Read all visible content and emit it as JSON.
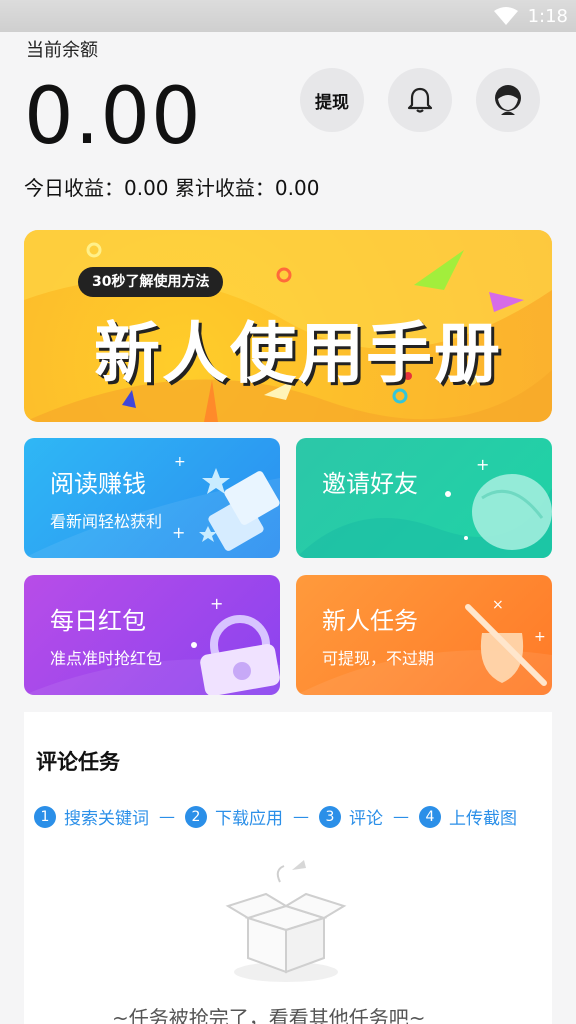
{
  "status": {
    "time": "1:18"
  },
  "balance": {
    "label": "当前余额",
    "amount": "0.00",
    "earnings": "今日收益：0.00 累计收益：0.00"
  },
  "header_buttons": {
    "withdraw_label": "提现"
  },
  "banner": {
    "pill_text": "30秒了解使用方法",
    "title": "新人使用手册"
  },
  "cards": [
    {
      "title": "阅读赚钱",
      "subtitle": "看新闻轻松获利"
    },
    {
      "title": "邀请好友",
      "subtitle": ""
    },
    {
      "title": "每日红包",
      "subtitle": "准点准时抢红包"
    },
    {
      "title": "新人任务",
      "subtitle": "可提现，不过期"
    }
  ],
  "comment_task": {
    "title": "评论任务",
    "steps": [
      {
        "num": "1",
        "label": "搜索关键词"
      },
      {
        "num": "2",
        "label": "下载应用"
      },
      {
        "num": "3",
        "label": "评论"
      },
      {
        "num": "4",
        "label": "上传截图"
      }
    ],
    "empty_text": "~任务被抢完了，看看其他任务吧~"
  },
  "colors": {
    "accent_blue": "#2b8fe8",
    "banner_yellow": "#fdbf2b",
    "card_blue": "#2b8ef0",
    "card_green": "#1fd3a6",
    "card_purple": "#8a43ef",
    "card_orange": "#ff7a28"
  }
}
